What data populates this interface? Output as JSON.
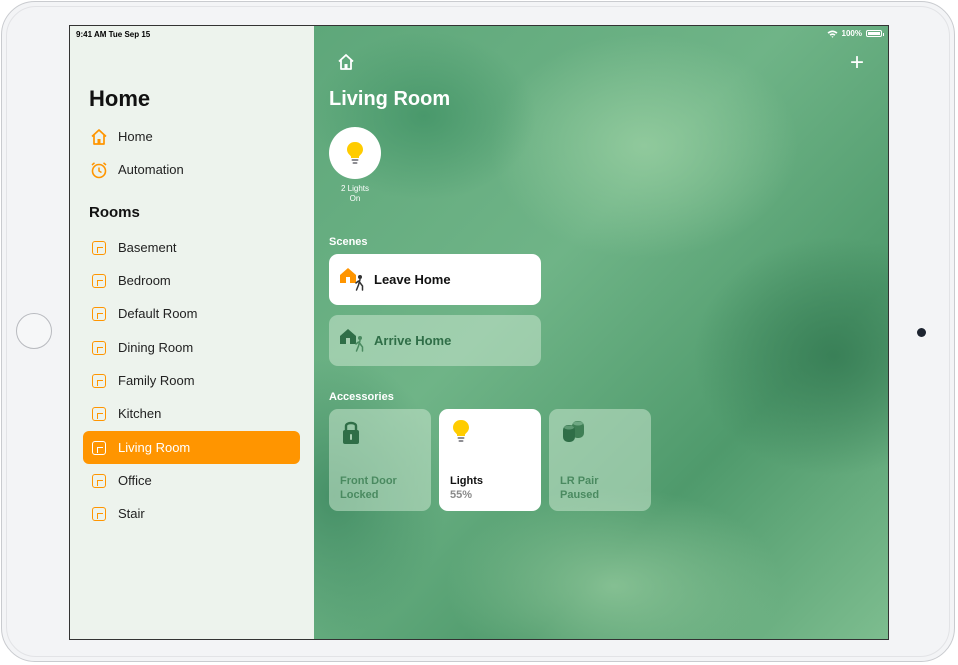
{
  "status_bar": {
    "time": "9:41 AM  Tue Sep 15",
    "battery": "100%"
  },
  "sidebar": {
    "title": "Home",
    "nav": [
      {
        "label": "Home",
        "icon": "house-icon"
      },
      {
        "label": "Automation",
        "icon": "clock-icon"
      }
    ],
    "rooms_header": "Rooms",
    "rooms": [
      {
        "label": "Basement",
        "selected": false
      },
      {
        "label": "Bedroom",
        "selected": false
      },
      {
        "label": "Default Room",
        "selected": false
      },
      {
        "label": "Dining Room",
        "selected": false
      },
      {
        "label": "Family Room",
        "selected": false
      },
      {
        "label": "Kitchen",
        "selected": false
      },
      {
        "label": "Living Room",
        "selected": true
      },
      {
        "label": "Office",
        "selected": false
      },
      {
        "label": "Stair",
        "selected": false
      }
    ]
  },
  "main": {
    "room_title": "Living Room",
    "status_bubble": {
      "label": "2 Lights On",
      "icon": "lightbulb-icon"
    },
    "scenes_header": "Scenes",
    "scenes": [
      {
        "label": "Leave Home",
        "active": true,
        "icon": "leave-home-icon"
      },
      {
        "label": "Arrive Home",
        "active": false,
        "icon": "arrive-home-icon"
      }
    ],
    "accessories_header": "Accessories",
    "accessories": [
      {
        "name": "Front Door",
        "state": "Locked",
        "on": false,
        "icon": "lock-icon"
      },
      {
        "name": "Lights",
        "state": "55%",
        "on": true,
        "icon": "lightbulb-icon"
      },
      {
        "name": "LR Pair",
        "state": "Paused",
        "on": false,
        "icon": "speaker-pair-icon"
      }
    ],
    "add_icon": "plus-icon",
    "home_icon": "house-icon"
  },
  "colors": {
    "accent": "#ff9500",
    "sidebar_bg": "#edf3ed",
    "main_green": "#5ea77a",
    "bulb_yellow": "#ffcc00"
  }
}
